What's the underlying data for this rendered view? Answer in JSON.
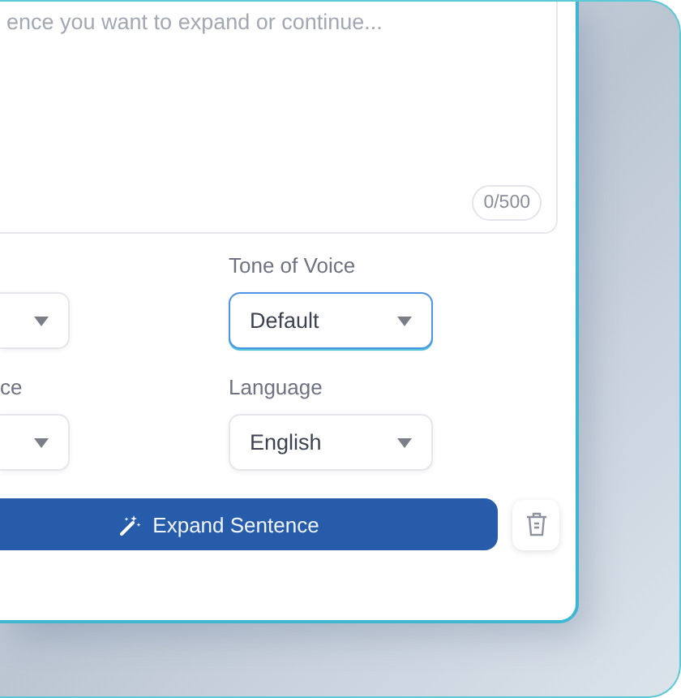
{
  "editor": {
    "placeholder": "ence you want to expand or continue...",
    "counter": "0/500"
  },
  "setting_rows": [
    {
      "left": {
        "focused": false
      },
      "right": {
        "label": "Tone of Voice",
        "value": "Default",
        "focused": true
      }
    },
    {
      "left": {
        "label": "ce",
        "focused": false
      },
      "right": {
        "label": "Language",
        "value": "English",
        "focused": false
      }
    }
  ],
  "actions": {
    "primary": "Expand Sentence"
  }
}
